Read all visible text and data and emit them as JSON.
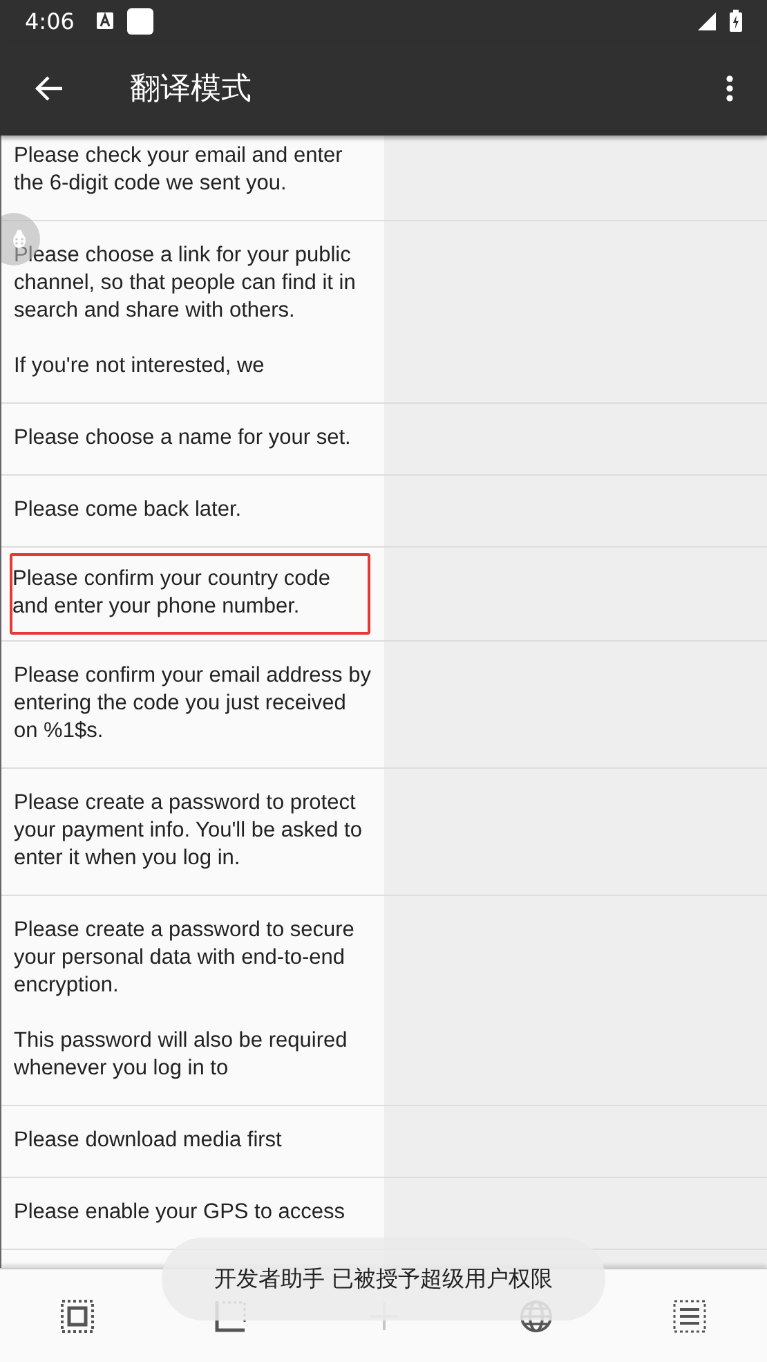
{
  "status_bar": {
    "time": "4:06"
  },
  "app_bar": {
    "title": "翻译模式"
  },
  "rows": [
    {
      "text": "Please check your email and enter the 6-digit code we sent you.",
      "selected": false
    },
    {
      "text": "Please choose a link for your public channel, so that people can find it in search and share with others.\n\nIf you're not interested, we",
      "selected": false
    },
    {
      "text": "Please choose a name for your set.",
      "selected": false
    },
    {
      "text": "Please come back later.",
      "selected": false
    },
    {
      "text": "Please confirm your country code and enter your phone number.",
      "selected": true
    },
    {
      "text": "Please confirm your email address by entering the code you just received on %1$s.",
      "selected": false
    },
    {
      "text": "Please create a password to protect your payment info. You'll be asked to enter it when you log in.",
      "selected": false
    },
    {
      "text": "Please create a password to secure your personal data with end-to-end encryption.\n\nThis password will also be required whenever you log in to",
      "selected": false
    },
    {
      "text": "Please download media first",
      "selected": false
    },
    {
      "text": "Please enable your GPS to access",
      "selected": false
    }
  ],
  "toolbar": [
    {
      "kind": "frame",
      "disabled": false
    },
    {
      "kind": "corner",
      "disabled": false
    },
    {
      "kind": "plus",
      "disabled": true
    },
    {
      "kind": "globe",
      "disabled": false
    },
    {
      "kind": "list",
      "disabled": false
    }
  ],
  "toast": {
    "text": "开发者助手 已被授予超级用户权限"
  }
}
